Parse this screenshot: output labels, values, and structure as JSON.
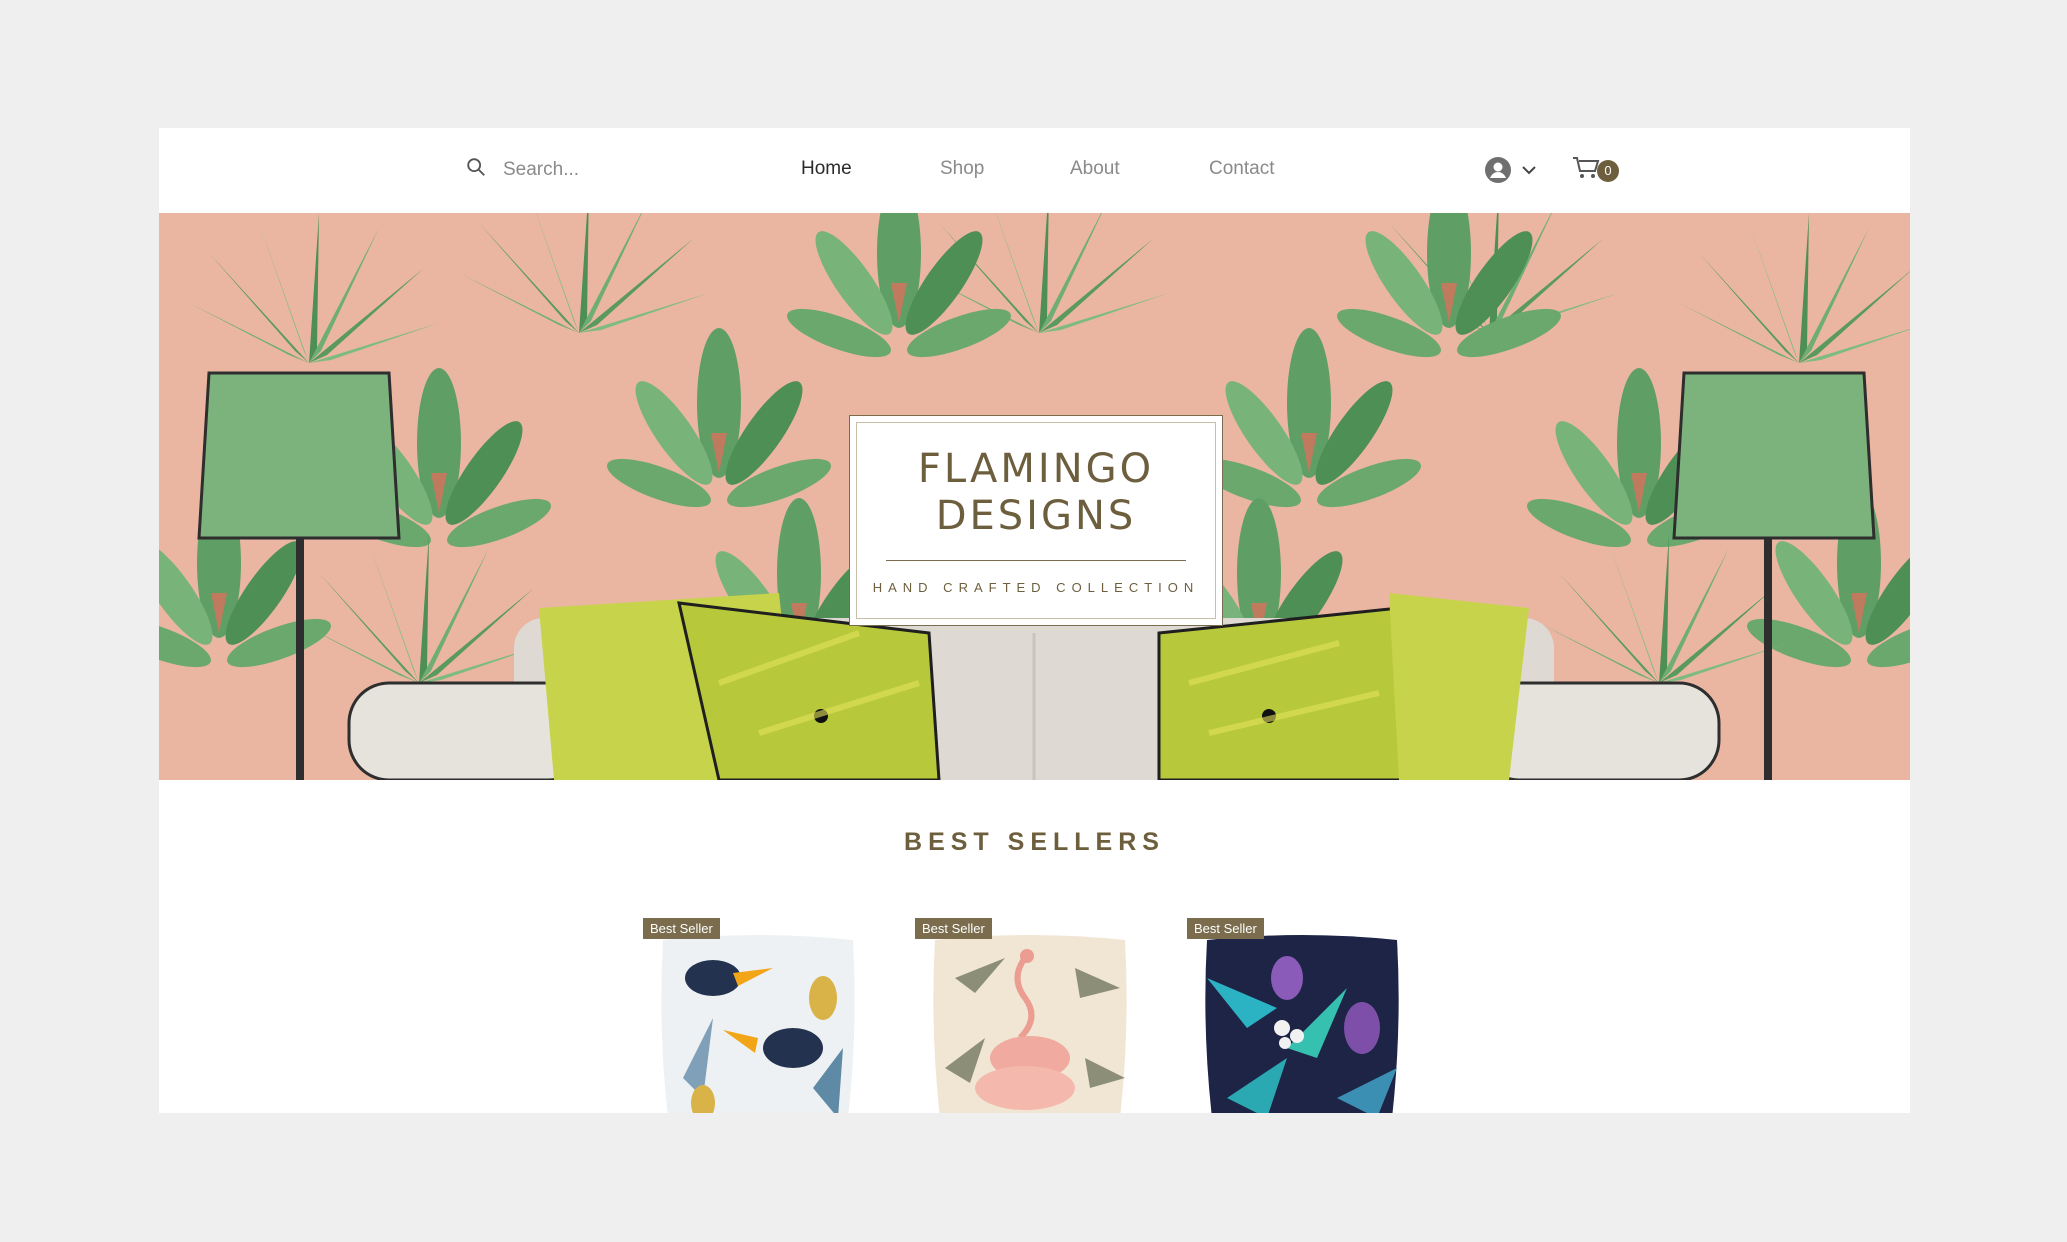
{
  "search": {
    "placeholder": "Search..."
  },
  "nav": {
    "items": [
      {
        "label": "Home",
        "active": true
      },
      {
        "label": "Shop",
        "active": false
      },
      {
        "label": "About",
        "active": false
      },
      {
        "label": "Contact",
        "active": false
      }
    ]
  },
  "account": {
    "icon": "user-icon",
    "dropdown_icon": "chevron-down-icon"
  },
  "cart": {
    "icon": "cart-icon",
    "count": "0"
  },
  "hero": {
    "title_line1": "FLAMINGO",
    "title_line2": "DESIGNS",
    "subtitle": "HAND CRAFTED COLLECTION"
  },
  "best_sellers": {
    "title": "BEST SELLERS",
    "products": [
      {
        "badge": "Best Seller",
        "pattern": "toucan-pineapple-pillow"
      },
      {
        "badge": "Best Seller",
        "pattern": "flamingo-palm-pillow"
      },
      {
        "badge": "Best Seller",
        "pattern": "tropical-floral-pillow"
      }
    ]
  },
  "colors": {
    "accent": "#6d5f3d",
    "page_background": "#efefef",
    "hero_background": "#e9b6a3",
    "leaf_green": "#5a9a5e"
  }
}
